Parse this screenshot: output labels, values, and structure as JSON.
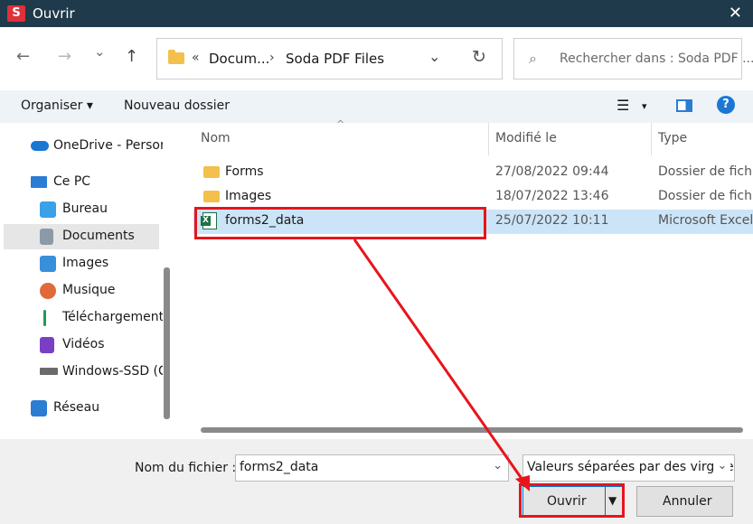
{
  "titlebar": {
    "app_icon": "S",
    "title": "Ouvrir",
    "close_glyph": "✕"
  },
  "nav": {
    "back_glyph": "←",
    "forward_glyph": "→",
    "recent_glyph": "⌄",
    "up_glyph": "↑",
    "breadcrumb_prefix": "«",
    "breadcrumb": [
      "Docum...",
      "Soda PDF Files"
    ],
    "breadcrumb_sep": "›",
    "dropdown_glyph": "⌄",
    "refresh_glyph": "↻",
    "search_placeholder": "Rechercher dans : Soda PDF ...",
    "search_glyph": "⌕"
  },
  "toolbar": {
    "organize": "Organiser ▾",
    "new_folder": "Nouveau dossier",
    "view_glyph": "☰",
    "view_caret": "▾",
    "help_glyph": "?"
  },
  "sidebar": {
    "items": [
      {
        "label": "OneDrive - Persor",
        "icon": "cloud-icon",
        "color": "#1a78d4"
      },
      {
        "label": "Ce PC",
        "icon": "computer-icon",
        "color": "#2b7cd3"
      },
      {
        "label": "Bureau",
        "icon": "desktop-icon",
        "color": "#3aa0e8"
      },
      {
        "label": "Documents",
        "icon": "documents-icon",
        "color": "#8a9aa8"
      },
      {
        "label": "Images",
        "icon": "pictures-icon",
        "color": "#3a8fd9"
      },
      {
        "label": "Musique",
        "icon": "music-icon",
        "color": "#e06a3a"
      },
      {
        "label": "Téléchargement",
        "icon": "download-icon",
        "color": "#1f9a5a"
      },
      {
        "label": "Vidéos",
        "icon": "videos-icon",
        "color": "#7b3fc4"
      },
      {
        "label": "Windows-SSD (C",
        "icon": "drive-icon",
        "color": "#6b6b6b"
      },
      {
        "label": "Réseau",
        "icon": "network-icon",
        "color": "#2b7cd3"
      }
    ]
  },
  "columns": {
    "name": "Nom",
    "modified": "Modifié le",
    "type": "Type",
    "sort_glyph": "^"
  },
  "files": [
    {
      "name": "Forms",
      "modified": "27/08/2022 09:44",
      "type": "Dossier de fichi",
      "kind": "folder"
    },
    {
      "name": "Images",
      "modified": "18/07/2022 13:46",
      "type": "Dossier de fichi",
      "kind": "folder"
    },
    {
      "name": "forms2_data",
      "modified": "25/07/2022 10:11",
      "type": "Microsoft Excel",
      "kind": "excel",
      "selected": true
    }
  ],
  "bottom": {
    "filename_label": "Nom du fichier :",
    "filename_value": "forms2_data",
    "filetype_value": "Valeurs séparées par des virgule",
    "dropdown_glyph": "⌄",
    "open_label": "Ouvrir",
    "open_caret": "▼",
    "cancel_label": "Annuler"
  },
  "annotation_color": "#e8141c",
  "excel_glyph": "X"
}
